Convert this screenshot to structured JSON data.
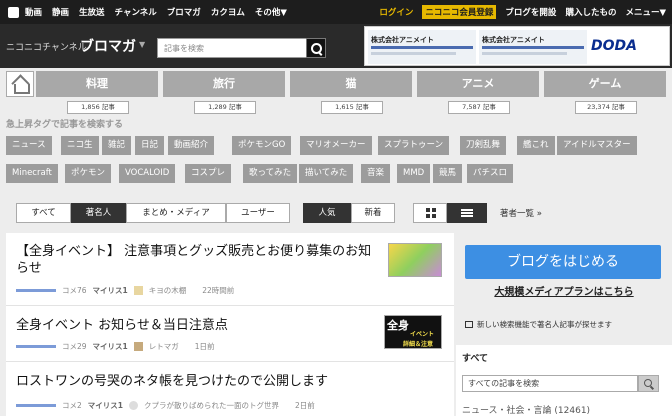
{
  "topbar": {
    "links": [
      "動画",
      "静画",
      "生放送",
      "チャンネル",
      "ブロマガ",
      "カクヨム",
      "その他▼"
    ],
    "login": "ログイン",
    "premium": "ニコニコ会員登録",
    "open_blog": "ブログを開設",
    "purchased": "購入したもの",
    "menu": "メニュー▼"
  },
  "header": {
    "brand_sub": "ニコニコチャンネル",
    "brand_main": "ブロマガ",
    "caret": "▼",
    "search_placeholder": "記事を検索"
  },
  "ad": {
    "company1": "株式会社アニメイト",
    "company2": "株式会社アニメイト",
    "brand": "DODA"
  },
  "categories": [
    {
      "label": "料理",
      "count": "1,856 記事"
    },
    {
      "label": "旅行",
      "count": "1,289 記事"
    },
    {
      "label": "猫",
      "count": "1,615 記事"
    },
    {
      "label": "アニメ",
      "count": "7,587 記事"
    },
    {
      "label": "ゲーム",
      "count": "23,374 記事"
    }
  ],
  "tags_title": "急上昇タグで記事を検索する",
  "tags_row1": [
    "ニュース",
    "ニコ生",
    "雑記",
    "日記",
    "動画紹介",
    "ポケモンGO",
    "マリオメーカー",
    "スプラトゥーン",
    "刀剣乱舞",
    "艦これ",
    "アイドルマスター"
  ],
  "tags_row2": [
    "Minecraft",
    "ポケモン",
    "VOCALOID",
    "コスプレ",
    "歌ってみた",
    "描いてみた",
    "音楽",
    "MMD",
    "競馬",
    "パチスロ"
  ],
  "filters": {
    "author_tabs": [
      "すべて",
      "著名人",
      "まとめ・メディア",
      "ユーザー"
    ],
    "sort_tabs": [
      "人気",
      "新着"
    ],
    "author_list": "著者一覧 »"
  },
  "articles": [
    {
      "title": "【全身イベント】 注意事項とグッズ販売とお便り募集のお知らせ",
      "comments": "コメ76",
      "mylist": "マイリス1",
      "author": "キヨの木棚",
      "time": "22時間前"
    },
    {
      "title": "全身イベント お知らせ＆当日注意点",
      "comments": "コメ29",
      "mylist": "マイリス1",
      "author": "レトマガ",
      "time": "1日前",
      "thumb_text": "全身",
      "thumb_sub": "イベント",
      "thumb_sub2": "詳細＆注意"
    },
    {
      "title": "ロストワンの号哭のネタ帳を見つけたので公開します",
      "comments": "コメ2",
      "mylist": "マイリス1",
      "author": "クプラが散りばめられた一面のトグ世界",
      "time": "2日前"
    }
  ],
  "sidebar": {
    "cta": "ブログをはじめる",
    "cta_sub": "大規模メディアプランはこちら",
    "notice": "新しい検索機能で著名人記事が探せます",
    "heading": "すべて",
    "search_placeholder": "すべての記事を検索",
    "first_category": "ニュース・社会・言論 (12461)"
  },
  "colors": {
    "cta_blue": "#3d8fe3",
    "accent_gold": "#e6b800",
    "tag_gray": "#9c9c9c"
  }
}
